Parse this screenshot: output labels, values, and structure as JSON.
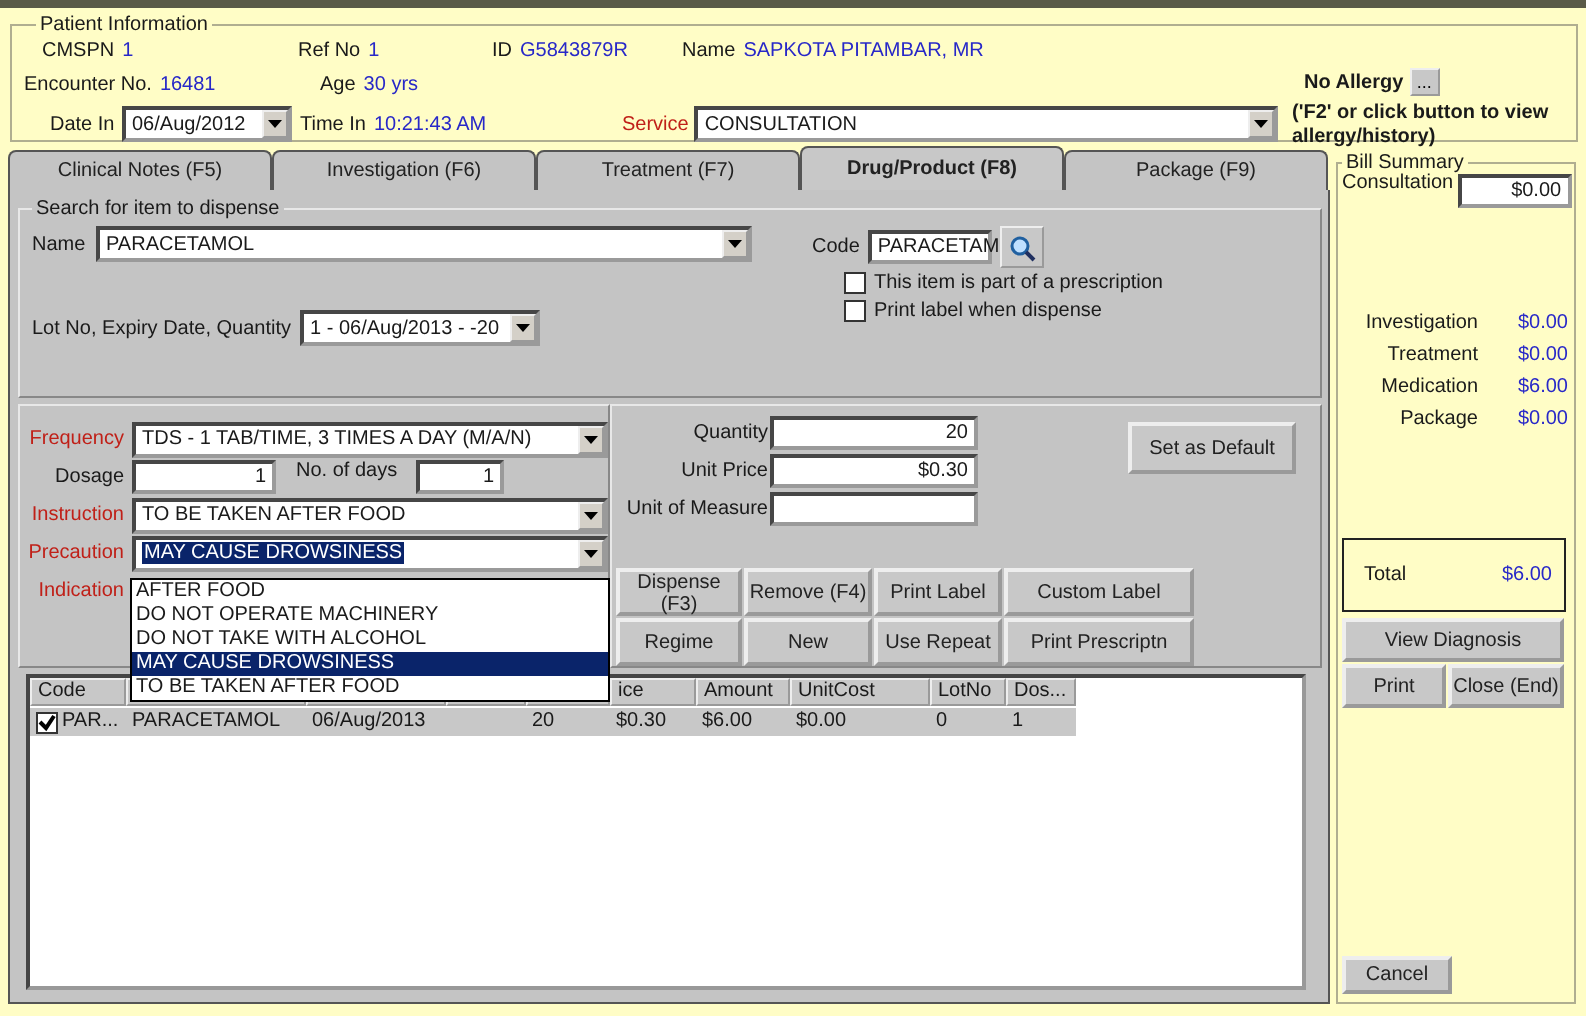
{
  "patient_info": {
    "title": "Patient Information",
    "row1": [
      {
        "label": "CMSPN",
        "value": "1"
      },
      {
        "label": "Ref No",
        "value": "1"
      },
      {
        "label": "ID",
        "value": "G5843879R"
      },
      {
        "label": "Name",
        "value": "SAPKOTA PITAMBAR, MR"
      }
    ],
    "row2": [
      {
        "label": "Encounter No.",
        "value": "16481"
      },
      {
        "label": "Age",
        "value": "30 yrs"
      }
    ],
    "date_label": "Date In",
    "date": "06/Aug/2012",
    "time_label": "Time In",
    "time": "10:21:43 AM",
    "service_label": "Service",
    "service": "CONSULTATION"
  },
  "allergy": {
    "label": "No Allergy",
    "button": "...",
    "hint": "('F2' or click button to view allergy/history)"
  },
  "tabs": [
    {
      "label": "Clinical Notes (F5)",
      "selected": false
    },
    {
      "label": "Investigation (F6)",
      "selected": false
    },
    {
      "label": "Treatment (F7)",
      "selected": false
    },
    {
      "label": "Drug/Product (F8)",
      "selected": true
    },
    {
      "label": "Package (F9)",
      "selected": false
    }
  ],
  "search": {
    "title": "Search for item to dispense",
    "name_label": "Name",
    "name": "PARACETAMOL",
    "code_label": "Code",
    "code": "PARACETAM",
    "options": [
      {
        "label": "This item is part of a prescription",
        "checked": false
      },
      {
        "label": "Print label when dispense",
        "checked": false
      }
    ],
    "lot_label": "Lot No, Expiry Date, Quantity",
    "lot": "1 - 06/Aug/2013 - -20"
  },
  "order": {
    "frequency_label": "Frequency",
    "frequency": "TDS - 1 TAB/TIME, 3 TIMES A DAY (M/A/N)",
    "dosage_label": "Dosage",
    "dosage": "1",
    "days_label": "No. of days",
    "days": "1",
    "instruction_label": "Instruction",
    "instruction": "TO BE TAKEN AFTER FOOD",
    "precaution_label": "Precaution",
    "precaution": "MAY CAUSE DROWSINESS",
    "indication_label": "Indication",
    "quantity_label": "Quantity",
    "quantity": "20",
    "price_label": "Unit Price",
    "price": "$0.30",
    "measure_label": "Unit of Measure",
    "default_button": "Set as Default"
  },
  "buttons": [
    [
      "Dispense (F3)",
      "Remove (F4)",
      "Print Label",
      "Custom Label"
    ],
    [
      "Regime",
      "New",
      "Use Repeat",
      "Print Prescriptn"
    ]
  ],
  "dropdown": {
    "options": [
      {
        "label": "AFTER FOOD",
        "selected": false
      },
      {
        "label": "DO NOT OPERATE MACHINERY",
        "selected": false
      },
      {
        "label": "DO NOT TAKE WITH ALCOHOL",
        "selected": false
      },
      {
        "label": "MAY CAUSE DROWSINESS",
        "selected": true
      },
      {
        "label": "TO BE TAKEN AFTER FOOD",
        "selected": false
      }
    ]
  },
  "table": {
    "columns": [
      "Code",
      "",
      "",
      "",
      "",
      "ice",
      "Amount",
      "UnitCost",
      "LotNo",
      "Dos..."
    ],
    "rows": [
      {
        "checked": true,
        "selected": true,
        "cells": [
          "PAR...",
          "PARACETAMOL",
          "06/Aug/2013",
          "",
          "20",
          "$0.30",
          "$6.00",
          "$0.00",
          "0",
          "1"
        ]
      }
    ]
  },
  "bill": {
    "title": "Bill Summary",
    "consultation_label": "Consultation",
    "consultation": "$0.00",
    "items": [
      {
        "label": "Investigation",
        "value": "$0.00"
      },
      {
        "label": "Treatment",
        "value": "$0.00"
      },
      {
        "label": "Medication",
        "value": "$6.00"
      },
      {
        "label": "Package",
        "value": "$0.00"
      }
    ],
    "total_label": "Total",
    "total": "$6.00",
    "buttons": [
      "View Diagnosis",
      "Print",
      "Close (End)"
    ],
    "cancel": "Cancel"
  }
}
